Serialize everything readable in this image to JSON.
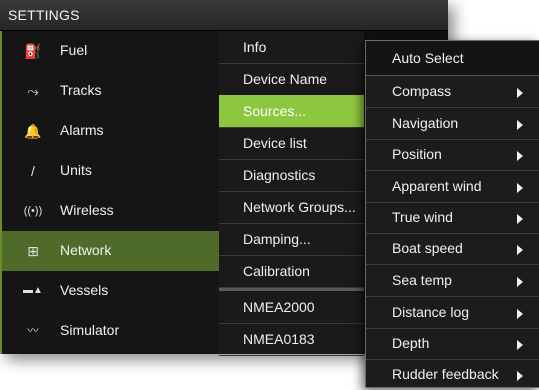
{
  "title": "SETTINGS",
  "left_menu": [
    {
      "label": "Fuel",
      "icon": "fuel-pump-icon",
      "glyph": "⛽"
    },
    {
      "label": "Tracks",
      "icon": "track-line-icon",
      "glyph": "⤳"
    },
    {
      "label": "Alarms",
      "icon": "bell-icon",
      "glyph": "🔔"
    },
    {
      "label": "Units",
      "icon": "ruler-pen-icon",
      "glyph": "/"
    },
    {
      "label": "Wireless",
      "icon": "wireless-icon",
      "glyph": "((•))"
    },
    {
      "label": "Network",
      "icon": "network-icon",
      "glyph": "⊞",
      "active": true
    },
    {
      "label": "Vessels",
      "icon": "vessels-icon",
      "glyph": "▬▲"
    },
    {
      "label": "Simulator",
      "icon": "simulator-icon",
      "glyph": "〰"
    }
  ],
  "network_menu": [
    {
      "label": "Info"
    },
    {
      "label": "Device Name"
    },
    {
      "label": "Sources...",
      "active": true
    },
    {
      "label": "Device list"
    },
    {
      "label": "Diagnostics"
    },
    {
      "label": "Network Groups..."
    },
    {
      "label": "Damping..."
    },
    {
      "label": "Calibration"
    },
    {
      "label": "NMEA2000"
    },
    {
      "label": "NMEA0183"
    }
  ],
  "sources_popup": {
    "first": "Auto Select",
    "items": [
      "Compass",
      "Navigation",
      "Position",
      "Apparent wind",
      "True wind",
      "Boat speed",
      "Sea temp",
      "Distance log",
      "Depth",
      "Rudder feedback"
    ]
  },
  "colors": {
    "accent_green": "#8dc63f",
    "active_dark_green": "#4f6b2a",
    "panel_bg": "#111111"
  }
}
